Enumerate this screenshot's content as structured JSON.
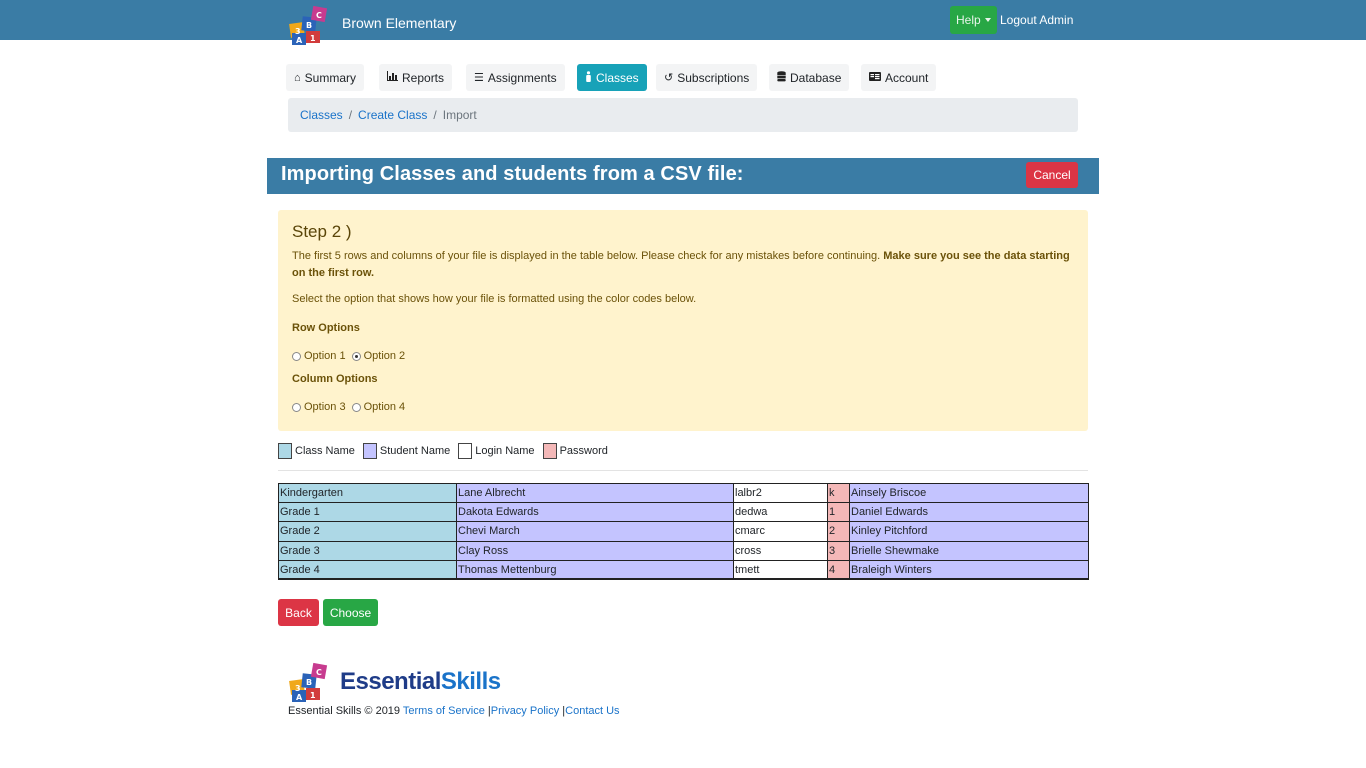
{
  "navbar": {
    "brand": "Brown Elementary",
    "help_label": "Help",
    "logout_label": "Logout Admin"
  },
  "tabs": [
    {
      "label": "Summary",
      "icon": "home-icon"
    },
    {
      "label": "Reports",
      "icon": "bar-chart-icon"
    },
    {
      "label": "Assignments",
      "icon": "list-icon"
    },
    {
      "label": "Classes",
      "icon": "person-icon"
    },
    {
      "label": "Subscriptions",
      "icon": "refresh-icon"
    },
    {
      "label": "Database",
      "icon": "database-icon"
    },
    {
      "label": "Account",
      "icon": "id-card-icon"
    }
  ],
  "breadcrumb": {
    "items": [
      "Classes",
      "Create Class"
    ],
    "current": "Import",
    "separator": "/"
  },
  "header": {
    "title": "Importing Classes and students from a CSV file:",
    "cancel_label": "Cancel"
  },
  "step": {
    "title": "Step 2 )",
    "text_plain": "The first 5 rows and columns of your file is displayed in the table below. Please check for any mistakes before continuing. ",
    "text_bold": "Make sure you see the data starting on the first row.",
    "instruction": "Select the option that shows how your file is formatted using the color codes below.",
    "row_options_label": "Row Options",
    "row_options": [
      "Option 1",
      "Option 2"
    ],
    "row_selected": "Option 2",
    "column_options_label": "Column Options",
    "column_options": [
      "Option 3",
      "Option 4"
    ],
    "column_selected": ""
  },
  "legend": [
    {
      "label": "Class Name",
      "color": "#add8e6"
    },
    {
      "label": "Student Name",
      "color": "#c4c4ff"
    },
    {
      "label": "Login Name",
      "color": "#ffffff"
    },
    {
      "label": "Password",
      "color": "#f4b8b8"
    }
  ],
  "table": {
    "rows": [
      [
        "Kindergarten",
        "Lane Albrecht",
        "lalbr2",
        "k",
        "Ainsely Briscoe"
      ],
      [
        "Grade 1",
        "Dakota Edwards",
        "dedwa",
        "1",
        "Daniel Edwards"
      ],
      [
        "Grade 2",
        "Chevi March",
        "cmarc",
        "2",
        "Kinley Pitchford"
      ],
      [
        "Grade 3",
        "Clay Ross",
        "cross",
        "3",
        "Brielle Shewmake"
      ],
      [
        "Grade 4",
        "Thomas Mettenburg",
        "tmett",
        "4",
        "Braleigh Winters"
      ]
    ]
  },
  "buttons": {
    "back_label": "Back",
    "choose_label": "Choose"
  },
  "footer": {
    "logo_word1": "Essential",
    "logo_word2": "Skills",
    "copyright": "Essential Skills © 2019 ",
    "links": [
      "Terms of Service",
      "Privacy Policy",
      "Contact Us"
    ]
  },
  "colors": {
    "navbar": "#3a7ca5",
    "active_tab": "#17a2b8",
    "danger": "#dc3545",
    "success": "#28a745",
    "warning_bg": "#fff3cd"
  }
}
